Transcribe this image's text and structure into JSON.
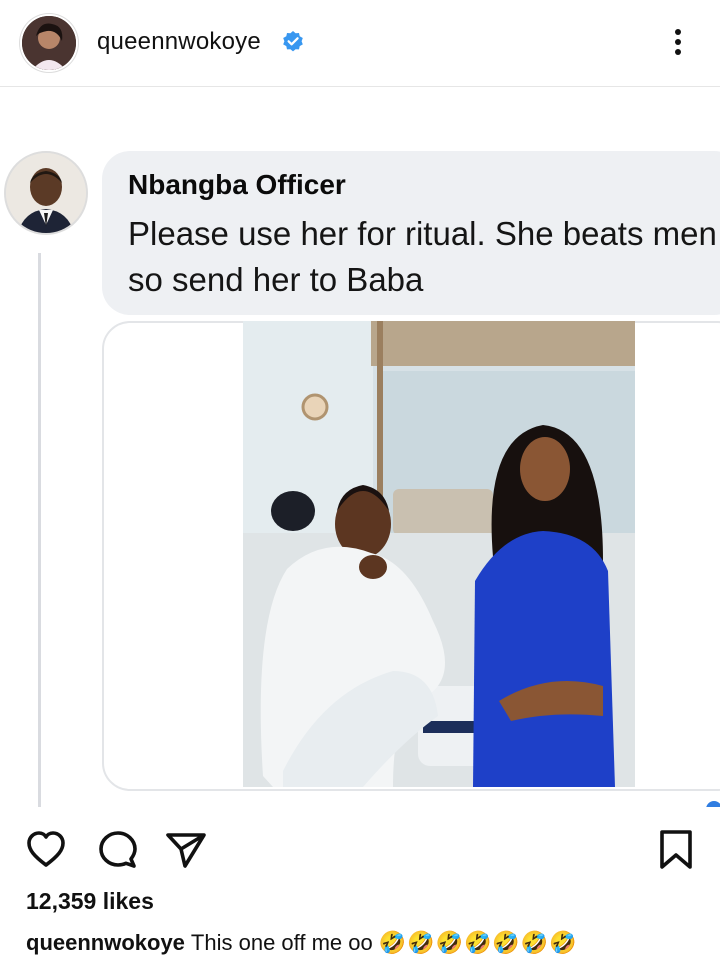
{
  "header": {
    "username": "queennwokoye",
    "verified_icon": "verified-badge-icon",
    "more_icon": "more-vertical-icon"
  },
  "comment": {
    "author": "Nbangba Officer",
    "text": "Please use her for ritual. She beats men so send her to Baba"
  },
  "actions": {
    "like_icon": "heart-icon",
    "comment_icon": "comment-icon",
    "share_icon": "send-icon",
    "save_icon": "bookmark-icon"
  },
  "likes": "12,359 likes",
  "caption": {
    "username": "queennwokoye",
    "text": "This one off me oo",
    "emojis": "🤣🤣🤣🤣🤣🤣🤣"
  },
  "colors": {
    "verified_blue": "#3897f0",
    "bubble_bg": "#eef0f3",
    "text": "#111111"
  }
}
